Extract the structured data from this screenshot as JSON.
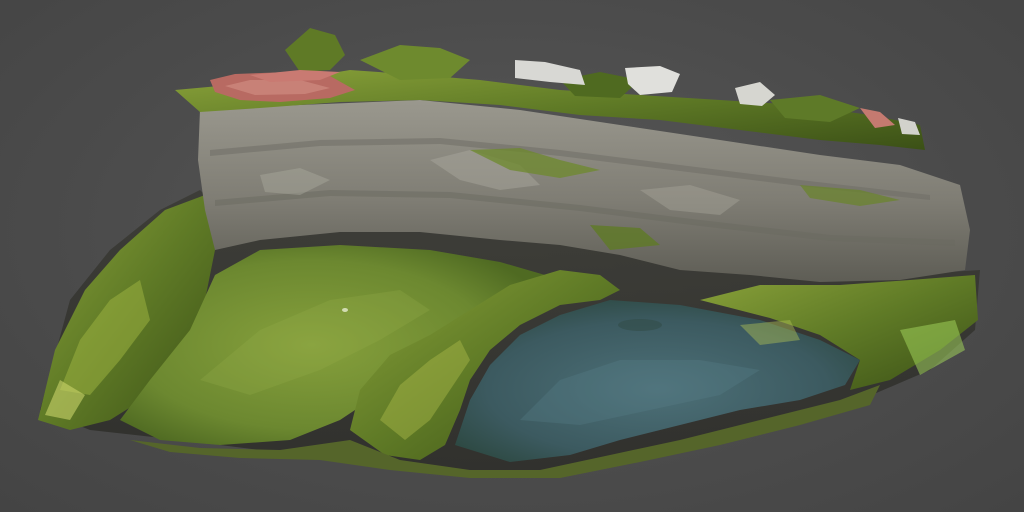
{
  "viewer": {
    "background_color": "#4a4a4a",
    "model": {
      "subject": "",
      "colors": {
        "cliff_rock": "#8a8880",
        "cliff_shadow": "#5d5d55",
        "vegetation": "#6f8a2e",
        "vegetation_dark": "#3e5218",
        "pond_green": "#6f8c32",
        "pond_blue": "#3f5f66",
        "roof_red": "#b86a62",
        "building_white": "#d8d8d4"
      }
    }
  }
}
